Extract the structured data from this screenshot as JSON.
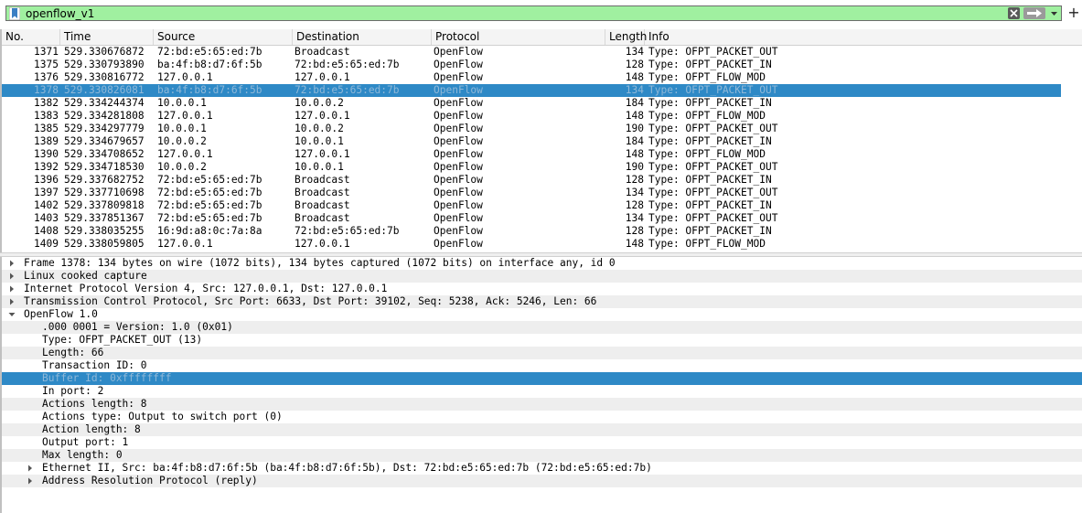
{
  "filter": {
    "value": "openflow_v1",
    "add_label": "+"
  },
  "columns": {
    "no": "No.",
    "time": "Time",
    "source": "Source",
    "destination": "Destination",
    "protocol": "Protocol",
    "length": "Length",
    "info": "Info"
  },
  "packets": [
    {
      "no": "1371",
      "time": "529.330676872",
      "src": "72:bd:e5:65:ed:7b",
      "dst": "Broadcast",
      "proto": "OpenFlow",
      "len": "134",
      "info": "Type: OFPT_PACKET_OUT"
    },
    {
      "no": "1375",
      "time": "529.330793890",
      "src": "ba:4f:b8:d7:6f:5b",
      "dst": "72:bd:e5:65:ed:7b",
      "proto": "OpenFlow",
      "len": "128",
      "info": "Type: OFPT_PACKET_IN"
    },
    {
      "no": "1376",
      "time": "529.330816772",
      "src": "127.0.0.1",
      "dst": "127.0.0.1",
      "proto": "OpenFlow",
      "len": "148",
      "info": "Type: OFPT_FLOW_MOD"
    },
    {
      "no": "1378",
      "time": "529.330826081",
      "src": "ba:4f:b8:d7:6f:5b",
      "dst": "72:bd:e5:65:ed:7b",
      "proto": "OpenFlow",
      "len": "134",
      "info": "Type: OFPT_PACKET_OUT"
    },
    {
      "no": "1382",
      "time": "529.334244374",
      "src": "10.0.0.1",
      "dst": "10.0.0.2",
      "proto": "OpenFlow",
      "len": "184",
      "info": "Type: OFPT_PACKET_IN"
    },
    {
      "no": "1383",
      "time": "529.334281808",
      "src": "127.0.0.1",
      "dst": "127.0.0.1",
      "proto": "OpenFlow",
      "len": "148",
      "info": "Type: OFPT_FLOW_MOD"
    },
    {
      "no": "1385",
      "time": "529.334297779",
      "src": "10.0.0.1",
      "dst": "10.0.0.2",
      "proto": "OpenFlow",
      "len": "190",
      "info": "Type: OFPT_PACKET_OUT"
    },
    {
      "no": "1389",
      "time": "529.334679657",
      "src": "10.0.0.2",
      "dst": "10.0.0.1",
      "proto": "OpenFlow",
      "len": "184",
      "info": "Type: OFPT_PACKET_IN"
    },
    {
      "no": "1390",
      "time": "529.334708652",
      "src": "127.0.0.1",
      "dst": "127.0.0.1",
      "proto": "OpenFlow",
      "len": "148",
      "info": "Type: OFPT_FLOW_MOD"
    },
    {
      "no": "1392",
      "time": "529.334718530",
      "src": "10.0.0.2",
      "dst": "10.0.0.1",
      "proto": "OpenFlow",
      "len": "190",
      "info": "Type: OFPT_PACKET_OUT"
    },
    {
      "no": "1396",
      "time": "529.337682752",
      "src": "72:bd:e5:65:ed:7b",
      "dst": "Broadcast",
      "proto": "OpenFlow",
      "len": "128",
      "info": "Type: OFPT_PACKET_IN"
    },
    {
      "no": "1397",
      "time": "529.337710698",
      "src": "72:bd:e5:65:ed:7b",
      "dst": "Broadcast",
      "proto": "OpenFlow",
      "len": "134",
      "info": "Type: OFPT_PACKET_OUT"
    },
    {
      "no": "1402",
      "time": "529.337809818",
      "src": "72:bd:e5:65:ed:7b",
      "dst": "Broadcast",
      "proto": "OpenFlow",
      "len": "128",
      "info": "Type: OFPT_PACKET_IN"
    },
    {
      "no": "1403",
      "time": "529.337851367",
      "src": "72:bd:e5:65:ed:7b",
      "dst": "Broadcast",
      "proto": "OpenFlow",
      "len": "134",
      "info": "Type: OFPT_PACKET_OUT"
    },
    {
      "no": "1408",
      "time": "529.338035255",
      "src": "16:9d:a8:0c:7a:8a",
      "dst": "72:bd:e5:65:ed:7b",
      "proto": "OpenFlow",
      "len": "128",
      "info": "Type: OFPT_PACKET_IN"
    },
    {
      "no": "1409",
      "time": "529.338059805",
      "src": "127.0.0.1",
      "dst": "127.0.0.1",
      "proto": "OpenFlow",
      "len": "148",
      "info": "Type: OFPT_FLOW_MOD"
    }
  ],
  "details": {
    "frame": "Frame 1378: 134 bytes on wire (1072 bits), 134 bytes captured (1072 bits) on interface any, id 0",
    "linux": "Linux cooked capture",
    "ip": "Internet Protocol Version 4, Src: 127.0.0.1, Dst: 127.0.0.1",
    "tcp": "Transmission Control Protocol, Src Port: 6633, Dst Port: 39102, Seq: 5238, Ack: 5246, Len: 66",
    "openflow": "OpenFlow 1.0",
    "of_fields": [
      ".000 0001 = Version: 1.0 (0x01)",
      "Type: OFPT_PACKET_OUT (13)",
      "Length: 66",
      "Transaction ID: 0",
      "Buffer Id: 0xffffffff",
      "In port: 2",
      "Actions length: 8",
      "Actions type: Output to switch port (0)",
      "Action length: 8",
      "Output port: 1",
      "Max length: 0"
    ],
    "ethernet": "Ethernet II, Src: ba:4f:b8:d7:6f:5b (ba:4f:b8:d7:6f:5b), Dst: 72:bd:e5:65:ed:7b (72:bd:e5:65:ed:7b)",
    "arp": "Address Resolution Protocol (reply)"
  },
  "colors": {
    "filter_valid": "#a0f0a0",
    "selection": "#2e89c6"
  }
}
